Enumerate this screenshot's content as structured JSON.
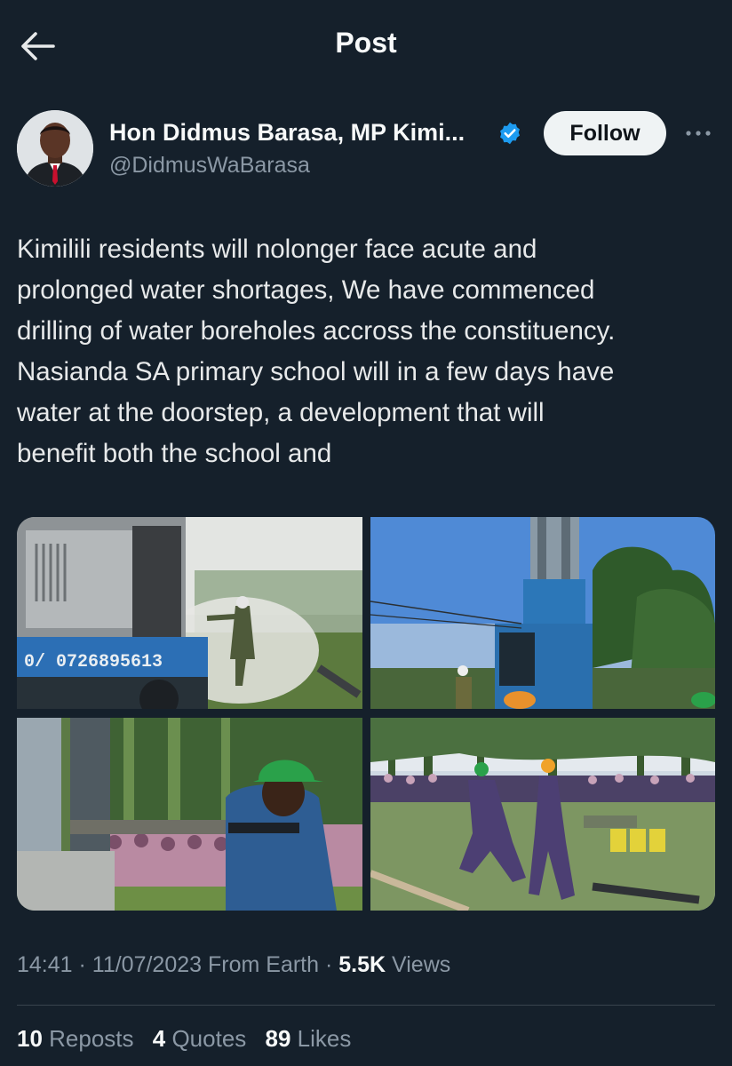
{
  "header": {
    "title": "Post",
    "back_icon": "arrow-left-icon"
  },
  "author": {
    "name": "Hon Didmus Barasa, MP Kimi...",
    "handle": "@DidmusWaBarasa",
    "verified": true,
    "verified_color": "#1d9bf0",
    "follow_label": "Follow",
    "more_icon": "ellipsis-icon"
  },
  "tweet": {
    "text": "Kimilili residents will nolonger face acute and\nprolonged water shortages, We have commenced\ndrilling of water boreholes accross the constituency.\nNasianda SA primary school will in a few days have\nwater at the doorstep, a development that will\nbenefit both the school and"
  },
  "media": {
    "truck_phone": "0/ 0726895613"
  },
  "meta": {
    "time": "14:41",
    "sep1": " · ",
    "date": "11/07/2023",
    "source": " From Earth",
    "sep2": " · ",
    "views_count": "5.5K",
    "views_label": " Views"
  },
  "stats": {
    "reposts_count": "10",
    "reposts_label": " Reposts",
    "quotes_count": "4",
    "quotes_label": " Quotes",
    "likes_count": "89",
    "likes_label": " Likes"
  },
  "colors": {
    "background": "#15202b",
    "muted": "#8b98a5",
    "follow_bg": "#eff3f4"
  }
}
